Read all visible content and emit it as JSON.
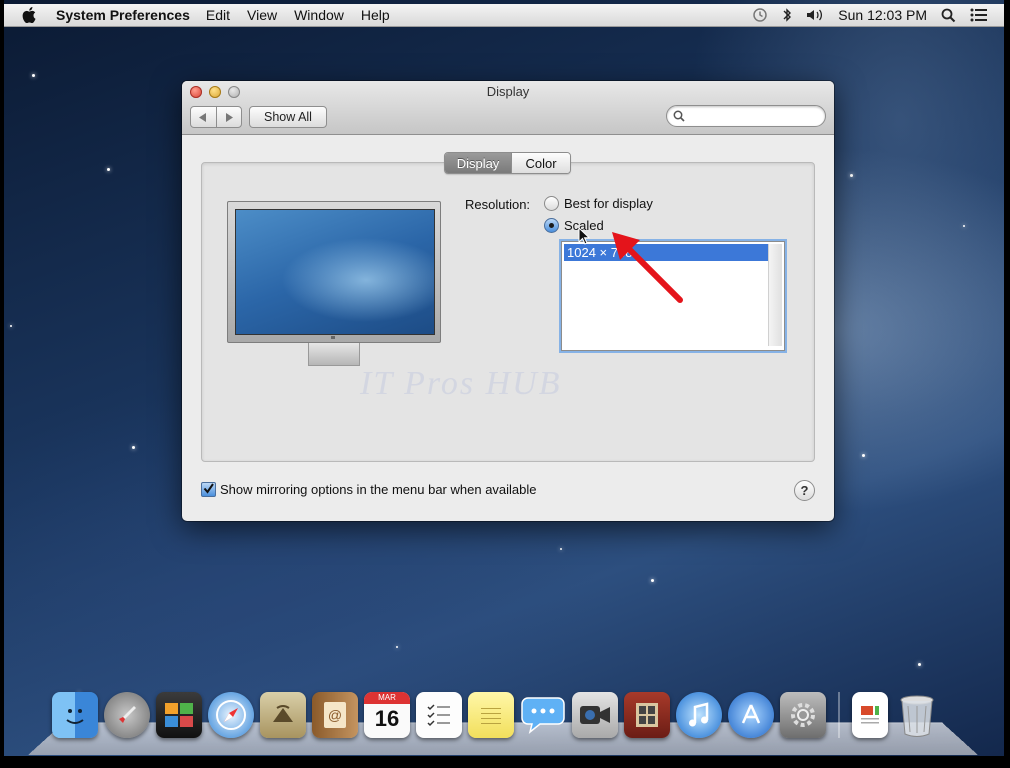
{
  "menubar": {
    "app_name": "System Preferences",
    "menus": [
      "Edit",
      "View",
      "Window",
      "Help"
    ],
    "clock": "Sun 12:03 PM",
    "status_icons": [
      "time-machine-icon",
      "bluetooth-icon",
      "volume-icon",
      "spotlight-icon",
      "notification-center-icon"
    ]
  },
  "window": {
    "title": "Display",
    "show_all_label": "Show All",
    "search_placeholder": "",
    "tabs": [
      "Display",
      "Color"
    ],
    "selected_tab": "Display",
    "resolution_label": "Resolution:",
    "options": [
      "Best for display",
      "Scaled"
    ],
    "selected_option": "Scaled",
    "resolution_list": [
      "1024 × 768"
    ],
    "selected_resolution": "1024 × 768",
    "watermark": "IT Pros HUB",
    "mirroring_label": "Show mirroring options in the menu bar when available",
    "mirroring_checked": true,
    "help_label": "?"
  },
  "dock": {
    "items": [
      "finder-icon",
      "launchpad-icon",
      "photo-booth-icon",
      "safari-icon",
      "mail-icon",
      "contacts-icon",
      "calendar-icon",
      "reminders-icon",
      "notes-icon",
      "messages-icon",
      "facetime-icon",
      "photo-viewer-icon",
      "itunes-icon",
      "app-store-icon",
      "system-preferences-icon",
      "document-icon",
      "trash-icon"
    ],
    "calendar_month": "MAR",
    "calendar_day": "16"
  },
  "colors": {
    "accent": "#3c78d8",
    "arrow": "#e4141b"
  }
}
